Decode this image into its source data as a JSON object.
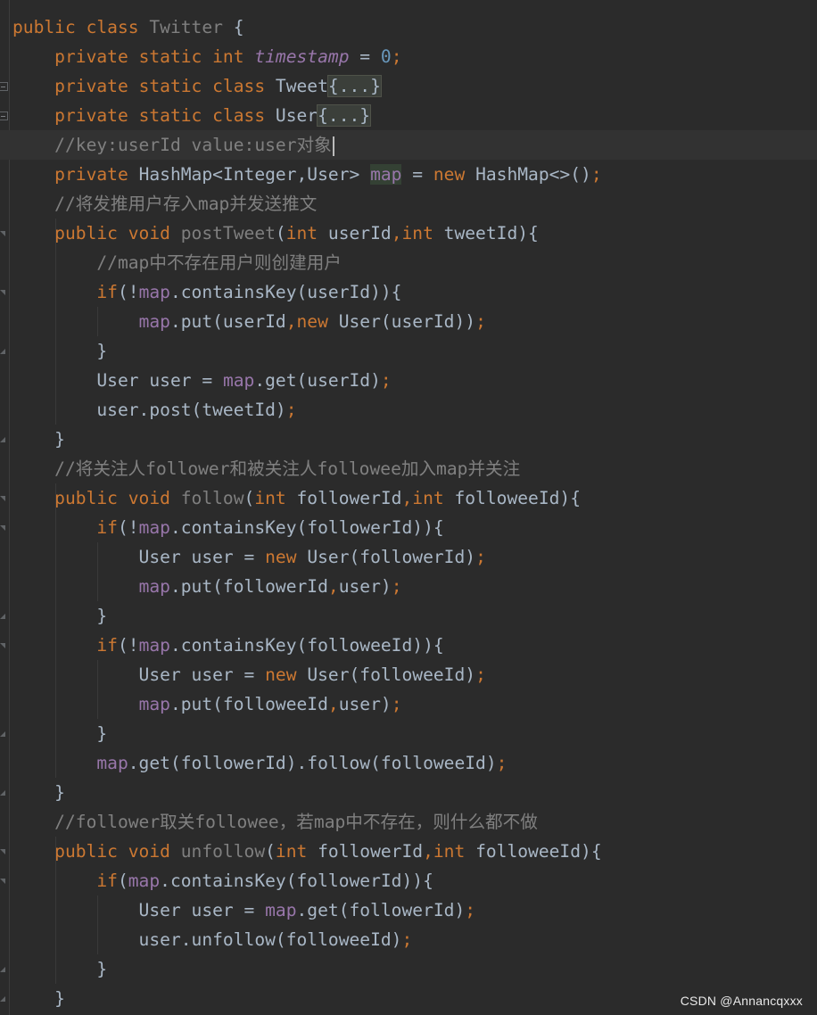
{
  "editor": {
    "lines": [
      {
        "id": "l1",
        "segments": [
          {
            "t": "public ",
            "c": "kw"
          },
          {
            "t": "class ",
            "c": "kw"
          },
          {
            "t": "Twitter ",
            "c": "fn-decl"
          },
          {
            "t": "{",
            "c": "txt"
          }
        ]
      },
      {
        "id": "l2",
        "segments": [
          {
            "t": "    private ",
            "c": "kw"
          },
          {
            "t": "static ",
            "c": "kw"
          },
          {
            "t": "int ",
            "c": "kw"
          },
          {
            "t": "timestamp",
            "c": "field-static"
          },
          {
            "t": " = ",
            "c": "txt"
          },
          {
            "t": "0",
            "c": "num"
          },
          {
            "t": ";",
            "c": "semi"
          }
        ]
      },
      {
        "id": "l3",
        "segments": [
          {
            "t": "    private ",
            "c": "kw"
          },
          {
            "t": "static ",
            "c": "kw"
          },
          {
            "t": "class ",
            "c": "kw"
          },
          {
            "t": "Tweet",
            "c": "txt"
          },
          {
            "t": "{...}",
            "c": "fold"
          }
        ]
      },
      {
        "id": "l4",
        "segments": [
          {
            "t": "    private ",
            "c": "kw"
          },
          {
            "t": "static ",
            "c": "kw"
          },
          {
            "t": "class ",
            "c": "kw"
          },
          {
            "t": "User",
            "c": "txt"
          },
          {
            "t": "{...}",
            "c": "fold"
          }
        ]
      },
      {
        "id": "l5",
        "current": true,
        "caret": true,
        "segments": [
          {
            "t": "    //key:userId value:user对象",
            "c": "cmt"
          }
        ]
      },
      {
        "id": "l6",
        "segments": [
          {
            "t": "    private ",
            "c": "kw"
          },
          {
            "t": "HashMap<Integer,User> ",
            "c": "txt"
          },
          {
            "t": "map",
            "c": "field-hl"
          },
          {
            "t": " = ",
            "c": "txt"
          },
          {
            "t": "new ",
            "c": "kw"
          },
          {
            "t": "HashMap<>()",
            "c": "txt"
          },
          {
            "t": ";",
            "c": "semi"
          }
        ]
      },
      {
        "id": "l7",
        "segments": [
          {
            "t": "    //将发推用户存入map并发送推文",
            "c": "cmt"
          }
        ]
      },
      {
        "id": "l8",
        "segments": [
          {
            "t": "    public ",
            "c": "kw"
          },
          {
            "t": "void ",
            "c": "kw"
          },
          {
            "t": "postTweet",
            "c": "fn-decl"
          },
          {
            "t": "(",
            "c": "txt"
          },
          {
            "t": "int ",
            "c": "kw"
          },
          {
            "t": "userId",
            "c": "txt"
          },
          {
            "t": ",",
            "c": "semi"
          },
          {
            "t": "int ",
            "c": "kw"
          },
          {
            "t": "tweetId){",
            "c": "txt"
          }
        ]
      },
      {
        "id": "l9",
        "segments": [
          {
            "t": "        //map中不存在用户则创建用户",
            "c": "cmt"
          }
        ]
      },
      {
        "id": "l10",
        "segments": [
          {
            "t": "        if",
            "c": "kw"
          },
          {
            "t": "(!",
            "c": "txt"
          },
          {
            "t": "map",
            "c": "field"
          },
          {
            "t": ".containsKey(userId)){",
            "c": "txt"
          }
        ]
      },
      {
        "id": "l11",
        "segments": [
          {
            "t": "            ",
            "c": "txt"
          },
          {
            "t": "map",
            "c": "field"
          },
          {
            "t": ".put(userId",
            "c": "txt"
          },
          {
            "t": ",",
            "c": "semi"
          },
          {
            "t": "new ",
            "c": "kw"
          },
          {
            "t": "User(userId))",
            "c": "txt"
          },
          {
            "t": ";",
            "c": "semi"
          }
        ]
      },
      {
        "id": "l12",
        "segments": [
          {
            "t": "        }",
            "c": "txt"
          }
        ]
      },
      {
        "id": "l13",
        "segments": [
          {
            "t": "        User user = ",
            "c": "txt"
          },
          {
            "t": "map",
            "c": "field"
          },
          {
            "t": ".get(userId)",
            "c": "txt"
          },
          {
            "t": ";",
            "c": "semi"
          }
        ]
      },
      {
        "id": "l14",
        "segments": [
          {
            "t": "        user.post(tweetId)",
            "c": "txt"
          },
          {
            "t": ";",
            "c": "semi"
          }
        ]
      },
      {
        "id": "l15",
        "segments": [
          {
            "t": "    }",
            "c": "txt"
          }
        ]
      },
      {
        "id": "l16",
        "segments": [
          {
            "t": "    //将关注人follower和被关注人followee加入map并关注",
            "c": "cmt"
          }
        ]
      },
      {
        "id": "l17",
        "segments": [
          {
            "t": "    public ",
            "c": "kw"
          },
          {
            "t": "void ",
            "c": "kw"
          },
          {
            "t": "follow",
            "c": "fn-decl"
          },
          {
            "t": "(",
            "c": "txt"
          },
          {
            "t": "int ",
            "c": "kw"
          },
          {
            "t": "followerId",
            "c": "txt"
          },
          {
            "t": ",",
            "c": "semi"
          },
          {
            "t": "int ",
            "c": "kw"
          },
          {
            "t": "followeeId){",
            "c": "txt"
          }
        ]
      },
      {
        "id": "l18",
        "segments": [
          {
            "t": "        if",
            "c": "kw"
          },
          {
            "t": "(!",
            "c": "txt"
          },
          {
            "t": "map",
            "c": "field"
          },
          {
            "t": ".containsKey(followerId)){",
            "c": "txt"
          }
        ]
      },
      {
        "id": "l19",
        "segments": [
          {
            "t": "            User user = ",
            "c": "txt"
          },
          {
            "t": "new ",
            "c": "kw"
          },
          {
            "t": "User(followerId)",
            "c": "txt"
          },
          {
            "t": ";",
            "c": "semi"
          }
        ]
      },
      {
        "id": "l20",
        "segments": [
          {
            "t": "            ",
            "c": "txt"
          },
          {
            "t": "map",
            "c": "field"
          },
          {
            "t": ".put(followerId",
            "c": "txt"
          },
          {
            "t": ",",
            "c": "semi"
          },
          {
            "t": "user)",
            "c": "txt"
          },
          {
            "t": ";",
            "c": "semi"
          }
        ]
      },
      {
        "id": "l21",
        "segments": [
          {
            "t": "        }",
            "c": "txt"
          }
        ]
      },
      {
        "id": "l22",
        "segments": [
          {
            "t": "        if",
            "c": "kw"
          },
          {
            "t": "(!",
            "c": "txt"
          },
          {
            "t": "map",
            "c": "field"
          },
          {
            "t": ".containsKey(followeeId)){",
            "c": "txt"
          }
        ]
      },
      {
        "id": "l23",
        "segments": [
          {
            "t": "            User user = ",
            "c": "txt"
          },
          {
            "t": "new ",
            "c": "kw"
          },
          {
            "t": "User(followeeId)",
            "c": "txt"
          },
          {
            "t": ";",
            "c": "semi"
          }
        ]
      },
      {
        "id": "l24",
        "segments": [
          {
            "t": "            ",
            "c": "txt"
          },
          {
            "t": "map",
            "c": "field"
          },
          {
            "t": ".put(followeeId",
            "c": "txt"
          },
          {
            "t": ",",
            "c": "semi"
          },
          {
            "t": "user)",
            "c": "txt"
          },
          {
            "t": ";",
            "c": "semi"
          }
        ]
      },
      {
        "id": "l25",
        "segments": [
          {
            "t": "        }",
            "c": "txt"
          }
        ]
      },
      {
        "id": "l26",
        "segments": [
          {
            "t": "        ",
            "c": "txt"
          },
          {
            "t": "map",
            "c": "field"
          },
          {
            "t": ".get(followerId).follow(followeeId)",
            "c": "txt"
          },
          {
            "t": ";",
            "c": "semi"
          }
        ]
      },
      {
        "id": "l27",
        "segments": [
          {
            "t": "    }",
            "c": "txt"
          }
        ]
      },
      {
        "id": "l28",
        "segments": [
          {
            "t": "    //follower取关followee，若map中不存在，则什么都不做",
            "c": "cmt"
          }
        ]
      },
      {
        "id": "l29",
        "segments": [
          {
            "t": "    public ",
            "c": "kw"
          },
          {
            "t": "void ",
            "c": "kw"
          },
          {
            "t": "unfollow",
            "c": "fn-decl"
          },
          {
            "t": "(",
            "c": "txt"
          },
          {
            "t": "int ",
            "c": "kw"
          },
          {
            "t": "followerId",
            "c": "txt"
          },
          {
            "t": ",",
            "c": "semi"
          },
          {
            "t": "int ",
            "c": "kw"
          },
          {
            "t": "followeeId){",
            "c": "txt"
          }
        ]
      },
      {
        "id": "l30",
        "segments": [
          {
            "t": "        if",
            "c": "kw"
          },
          {
            "t": "(",
            "c": "txt"
          },
          {
            "t": "map",
            "c": "field"
          },
          {
            "t": ".containsKey(followerId)){",
            "c": "txt"
          }
        ]
      },
      {
        "id": "l31",
        "segments": [
          {
            "t": "            User user = ",
            "c": "txt"
          },
          {
            "t": "map",
            "c": "field"
          },
          {
            "t": ".get(followerId)",
            "c": "txt"
          },
          {
            "t": ";",
            "c": "semi"
          }
        ]
      },
      {
        "id": "l32",
        "segments": [
          {
            "t": "            user.unfollow(followeeId)",
            "c": "txt"
          },
          {
            "t": ";",
            "c": "semi"
          }
        ]
      },
      {
        "id": "l33",
        "segments": [
          {
            "t": "        }",
            "c": "txt"
          }
        ]
      },
      {
        "id": "l34",
        "segments": [
          {
            "t": "    }",
            "c": "txt"
          }
        ]
      }
    ]
  },
  "watermark": "CSDN @Annancqxxx"
}
